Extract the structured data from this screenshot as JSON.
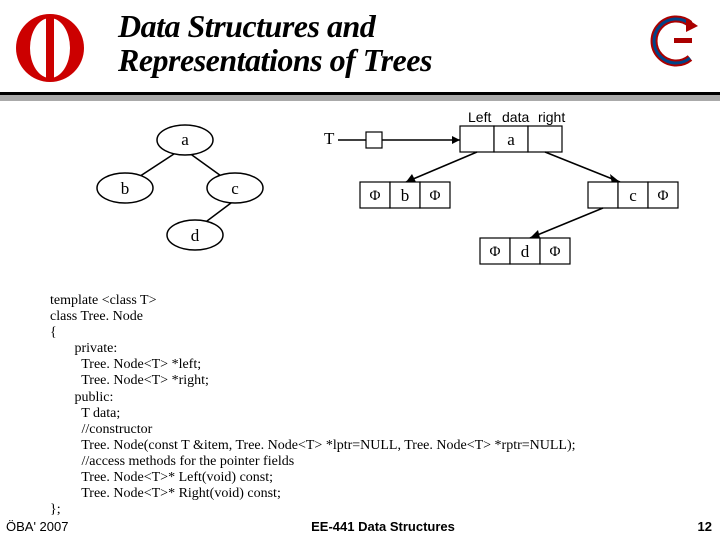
{
  "title_line1": "Data Structures and",
  "title_line2": "Representations of Trees",
  "tree": {
    "a": "a",
    "b": "b",
    "c": "c",
    "d": "d"
  },
  "record": {
    "hdr_left": "Left",
    "hdr_data": "data",
    "hdr_right": "right",
    "T": "T",
    "phi": "Φ",
    "a": "a",
    "b": "b",
    "c": "c",
    "d": "d"
  },
  "code": {
    "l1": "template <class T>",
    "l2": "class Tree. Node",
    "l3": "{",
    "l4": "       private:",
    "l5": "         Tree. Node<T> *left;",
    "l6": "         Tree. Node<T> *right;",
    "l7": "       public:",
    "l8": "         T data;",
    "l9": "         //constructor",
    "l10": "         Tree. Node(const T &item, Tree. Node<T> *lptr=NULL, Tree. Node<T> *rptr=NULL);",
    "l11": "         //access methods for the pointer fields",
    "l12": "         Tree. Node<T>* Left(void) const;",
    "l13": "         Tree. Node<T>* Right(void) const;",
    "l14": "};"
  },
  "footer": {
    "left": "ÖBA' 2007",
    "center": "EE-441 Data Structures",
    "page": "12"
  }
}
